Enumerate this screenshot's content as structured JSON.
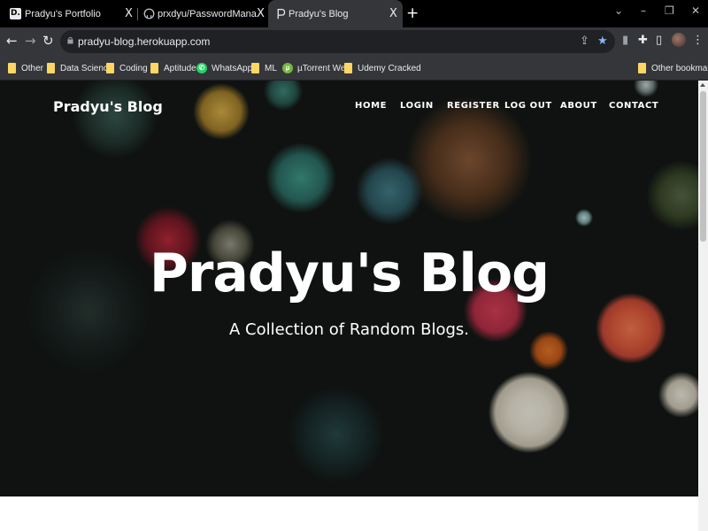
{
  "browser": {
    "tabs": [
      {
        "title": "Pradyu's Portfolio",
        "favicon": "portfolio-d-icon",
        "favicon_text": "D."
      },
      {
        "title": "prxdyu/PasswordManager: Passw",
        "favicon": "github-icon"
      },
      {
        "title": "Pradyu's Blog",
        "favicon": "blog-p-icon"
      }
    ],
    "close_glyph": "X",
    "new_tab_glyph": "+",
    "window_controls": {
      "minimize": "–",
      "maximize": "❐",
      "close": "✕",
      "tab_search": "⌄"
    },
    "url": "pradyu-blog.herokuapp.com",
    "bookmarks": [
      {
        "label": "Other",
        "icon": "folder-icon"
      },
      {
        "label": "Data Science",
        "icon": "folder-icon"
      },
      {
        "label": "Coding",
        "icon": "folder-icon"
      },
      {
        "label": "Aptitude",
        "icon": "folder-icon"
      },
      {
        "label": "WhatsApp",
        "icon": "whatsapp-icon"
      },
      {
        "label": "ML",
        "icon": "folder-icon"
      },
      {
        "label": "µTorrent Web",
        "icon": "utorrent-icon"
      },
      {
        "label": "Udemy Cracked",
        "icon": "folder-icon"
      }
    ],
    "other_bookmarks": "Other bookmarks",
    "accent_star_color": "#8ab4f8"
  },
  "site": {
    "brand": "Pradyu's Blog",
    "nav": [
      "HOME",
      "LOGIN",
      "REGISTER",
      "LOG OUT",
      "ABOUT",
      "CONTACT"
    ],
    "hero_title": "Pradyu's Blog",
    "hero_subtitle": "A Collection of Random Blogs."
  }
}
